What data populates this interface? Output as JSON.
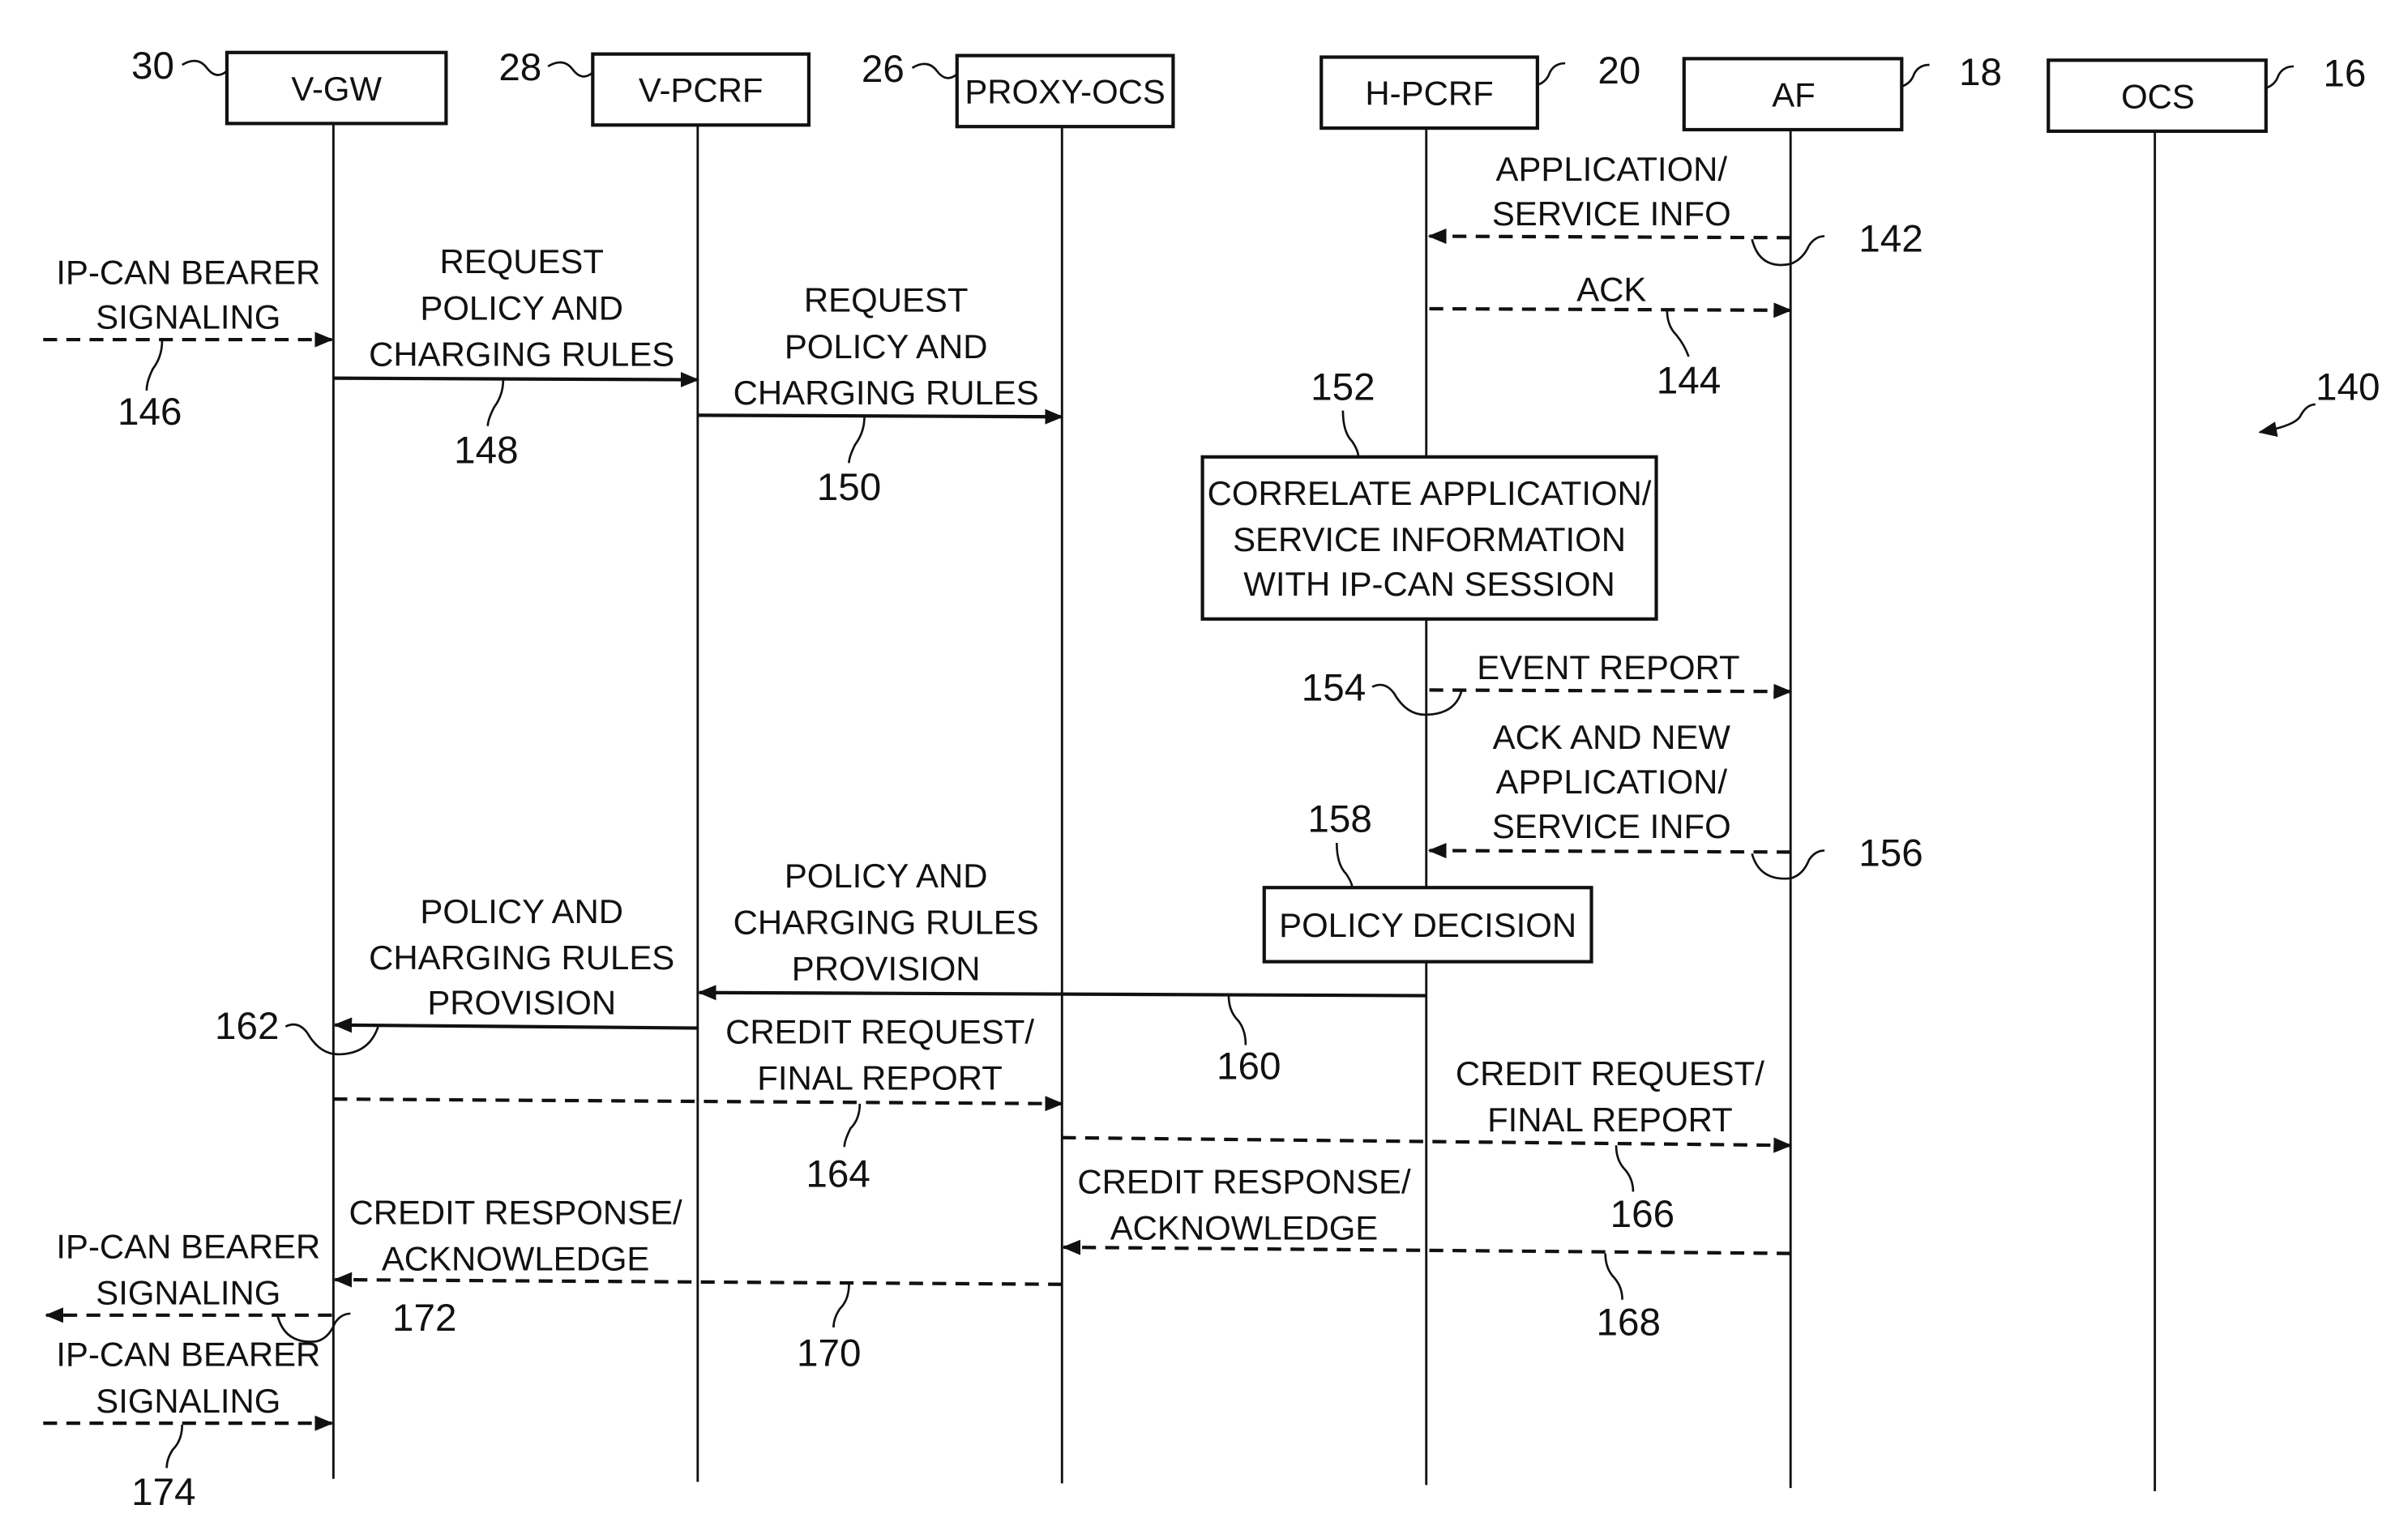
{
  "figure_ref": "140",
  "entities": [
    {
      "id": "vgw",
      "label": "V-GW",
      "ref": "30"
    },
    {
      "id": "vpcrf",
      "label": "V-PCRF",
      "ref": "28"
    },
    {
      "id": "proxyocs",
      "label": "PROXY-OCS",
      "ref": "26"
    },
    {
      "id": "hpcrf",
      "label": "H-PCRF",
      "ref": "20"
    },
    {
      "id": "af",
      "label": "AF",
      "ref": "18"
    },
    {
      "id": "ocs",
      "label": "OCS",
      "ref": "16"
    }
  ],
  "messages": [
    {
      "ref": "142",
      "from": "af",
      "to": "hpcrf",
      "style": "dashed",
      "lines": [
        "APPLICATION/",
        "SERVICE INFO"
      ]
    },
    {
      "ref": "144",
      "from": "hpcrf",
      "to": "af",
      "style": "dashed",
      "lines": [
        "ACK"
      ]
    },
    {
      "ref": "146",
      "from": "external",
      "to": "vgw",
      "style": "dashed",
      "lines": [
        "IP-CAN BEARER",
        "SIGNALING"
      ]
    },
    {
      "ref": "148",
      "from": "vgw",
      "to": "vpcrf",
      "style": "solid",
      "lines": [
        "REQUEST",
        "POLICY AND",
        "CHARGING RULES"
      ]
    },
    {
      "ref": "150",
      "from": "vpcrf",
      "to": "proxyocs",
      "style": "solid",
      "lines": [
        "REQUEST",
        "POLICY AND",
        "CHARGING RULES"
      ]
    },
    {
      "ref": "154",
      "from": "hpcrf",
      "to": "af",
      "style": "dashed",
      "lines": [
        "EVENT REPORT"
      ]
    },
    {
      "ref": "156",
      "from": "af",
      "to": "hpcrf",
      "style": "dashed",
      "lines": [
        "ACK AND NEW",
        "APPLICATION/",
        "SERVICE INFO"
      ]
    },
    {
      "ref": "160",
      "from": "hpcrf",
      "to": "vpcrf",
      "style": "solid",
      "lines": [
        "POLICY AND",
        "CHARGING RULES",
        "PROVISION"
      ]
    },
    {
      "ref": "162",
      "from": "vpcrf",
      "to": "vgw",
      "style": "solid",
      "lines": [
        "POLICY AND",
        "CHARGING RULES",
        "PROVISION"
      ]
    },
    {
      "ref": "164",
      "from": "vgw",
      "to": "proxyocs",
      "style": "dashed",
      "lines": [
        "CREDIT REQUEST/",
        "FINAL REPORT"
      ]
    },
    {
      "ref": "166",
      "from": "proxyocs",
      "to": "af",
      "style": "dashed",
      "lines": [
        "CREDIT REQUEST/",
        "FINAL REPORT"
      ]
    },
    {
      "ref": "168",
      "from": "af",
      "to": "proxyocs",
      "style": "dashed",
      "lines": [
        "CREDIT RESPONSE/",
        "ACKNOWLEDGE"
      ]
    },
    {
      "ref": "170",
      "from": "proxyocs",
      "to": "vgw",
      "style": "dashed",
      "lines": [
        "CREDIT RESPONSE/",
        "ACKNOWLEDGE"
      ]
    },
    {
      "ref": "172",
      "from": "vgw",
      "to": "external",
      "style": "dashed",
      "lines": [
        "IP-CAN BEARER",
        "SIGNALING"
      ]
    },
    {
      "ref": "174",
      "from": "external",
      "to": "vgw",
      "style": "dashed",
      "lines": [
        "IP-CAN BEARER",
        "SIGNALING"
      ]
    }
  ],
  "processes": [
    {
      "ref": "152",
      "on": "hpcrf",
      "lines": [
        "CORRELATE APPLICATION/",
        "SERVICE INFORMATION",
        "WITH IP-CAN SESSION"
      ]
    },
    {
      "ref": "158",
      "on": "hpcrf",
      "lines": [
        "POLICY DECISION"
      ]
    }
  ]
}
